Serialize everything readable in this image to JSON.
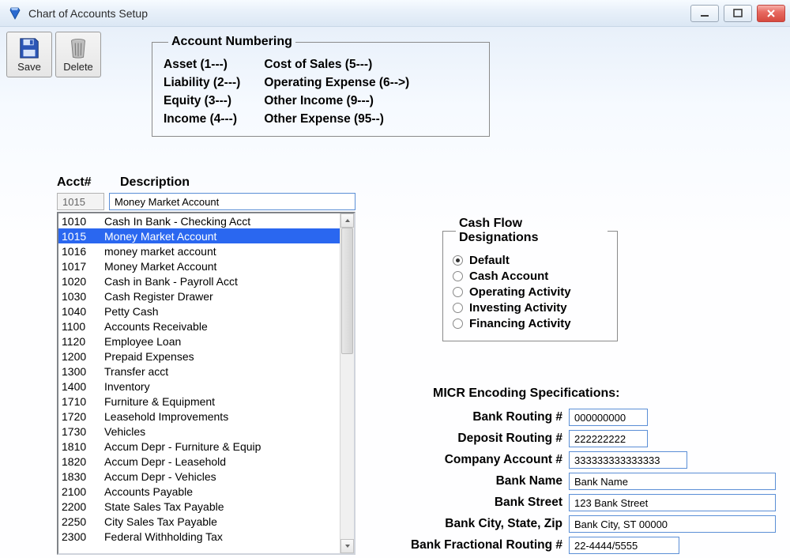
{
  "window": {
    "title": "Chart of Accounts Setup"
  },
  "toolbar": {
    "save_label": "Save",
    "delete_label": "Delete"
  },
  "numbering": {
    "legend": "Account Numbering",
    "left": [
      "Asset (1---)",
      "Liability (2---)",
      "Equity (3---)",
      "Income (4---)"
    ],
    "right": [
      "Cost of Sales (5---)",
      "Operating Expense (6-->)",
      "Other Income (9---)",
      "Other Expense (95--)"
    ]
  },
  "list": {
    "header_acct": "Acct#",
    "header_desc": "Description",
    "input_acct": "1015",
    "input_desc": "Money Market Account",
    "selected_index": 1,
    "accounts": [
      {
        "num": "1010",
        "desc": "Cash In Bank - Checking Acct"
      },
      {
        "num": "1015",
        "desc": "Money Market Account"
      },
      {
        "num": "1016",
        "desc": "money market account"
      },
      {
        "num": "1017",
        "desc": "Money Market Account"
      },
      {
        "num": "1020",
        "desc": "Cash in Bank - Payroll Acct"
      },
      {
        "num": "1030",
        "desc": "Cash Register Drawer"
      },
      {
        "num": "1040",
        "desc": "Petty Cash"
      },
      {
        "num": "1100",
        "desc": "Accounts Receivable"
      },
      {
        "num": "1120",
        "desc": "Employee Loan"
      },
      {
        "num": "1200",
        "desc": "Prepaid Expenses"
      },
      {
        "num": "1300",
        "desc": "Transfer acct"
      },
      {
        "num": "1400",
        "desc": "Inventory"
      },
      {
        "num": "1710",
        "desc": "Furniture & Equipment"
      },
      {
        "num": "1720",
        "desc": "Leasehold Improvements"
      },
      {
        "num": "1730",
        "desc": "Vehicles"
      },
      {
        "num": "1810",
        "desc": "Accum Depr - Furniture & Equip"
      },
      {
        "num": "1820",
        "desc": "Accum Depr - Leasehold"
      },
      {
        "num": "1830",
        "desc": "Accum Depr - Vehicles"
      },
      {
        "num": "2100",
        "desc": "Accounts Payable"
      },
      {
        "num": "2200",
        "desc": "State Sales Tax Payable"
      },
      {
        "num": "2250",
        "desc": "City Sales Tax Payable"
      },
      {
        "num": "2300",
        "desc": "Federal Withholding Tax"
      }
    ]
  },
  "cashflow": {
    "legend": "Cash Flow Designations",
    "selected": 0,
    "options": [
      "Default",
      "Cash Account",
      "Operating Activity",
      "Investing Activity",
      "Financing Activity"
    ]
  },
  "micr": {
    "title": "MICR Encoding Specifications:",
    "labels": {
      "bank_routing": "Bank Routing #",
      "deposit_routing": "Deposit Routing #",
      "company_account": "Company Account #",
      "bank_name": "Bank Name",
      "bank_street": "Bank Street",
      "bank_csz": "Bank City, State, Zip",
      "fractional_routing": "Bank Fractional Routing #"
    },
    "values": {
      "bank_routing": "000000000",
      "deposit_routing": "222222222",
      "company_account": "333333333333333",
      "bank_name": "Bank Name",
      "bank_street": "123 Bank Street",
      "bank_csz": "Bank City, ST 00000",
      "fractional_routing": "22-4444/5555"
    }
  }
}
